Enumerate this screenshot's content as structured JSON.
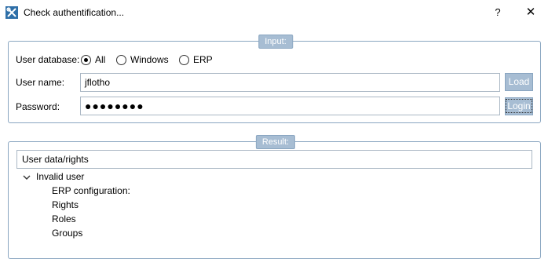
{
  "window": {
    "title": "Check authentification...",
    "help": "?",
    "close": "✕"
  },
  "input_group": {
    "title": "Input:",
    "user_database_label": "User database:",
    "radios": [
      {
        "label": "All",
        "checked": true
      },
      {
        "label": "Windows",
        "checked": false
      },
      {
        "label": "ERP",
        "checked": false
      }
    ],
    "user_name_label": "User name:",
    "user_name_value": "jflotho",
    "password_label": "Password:",
    "password_value": "●●●●●●●●",
    "load_button": "Load",
    "login_button": "Login"
  },
  "result_group": {
    "title": "Result:",
    "column_header": "User data/rights",
    "tree": {
      "root": "Invalid user",
      "children": [
        "ERP configuration:",
        "Rights",
        "Roles",
        "Groups"
      ]
    }
  },
  "colors": {
    "accent": "#a7bdd3",
    "border": "#8aa6c1"
  }
}
